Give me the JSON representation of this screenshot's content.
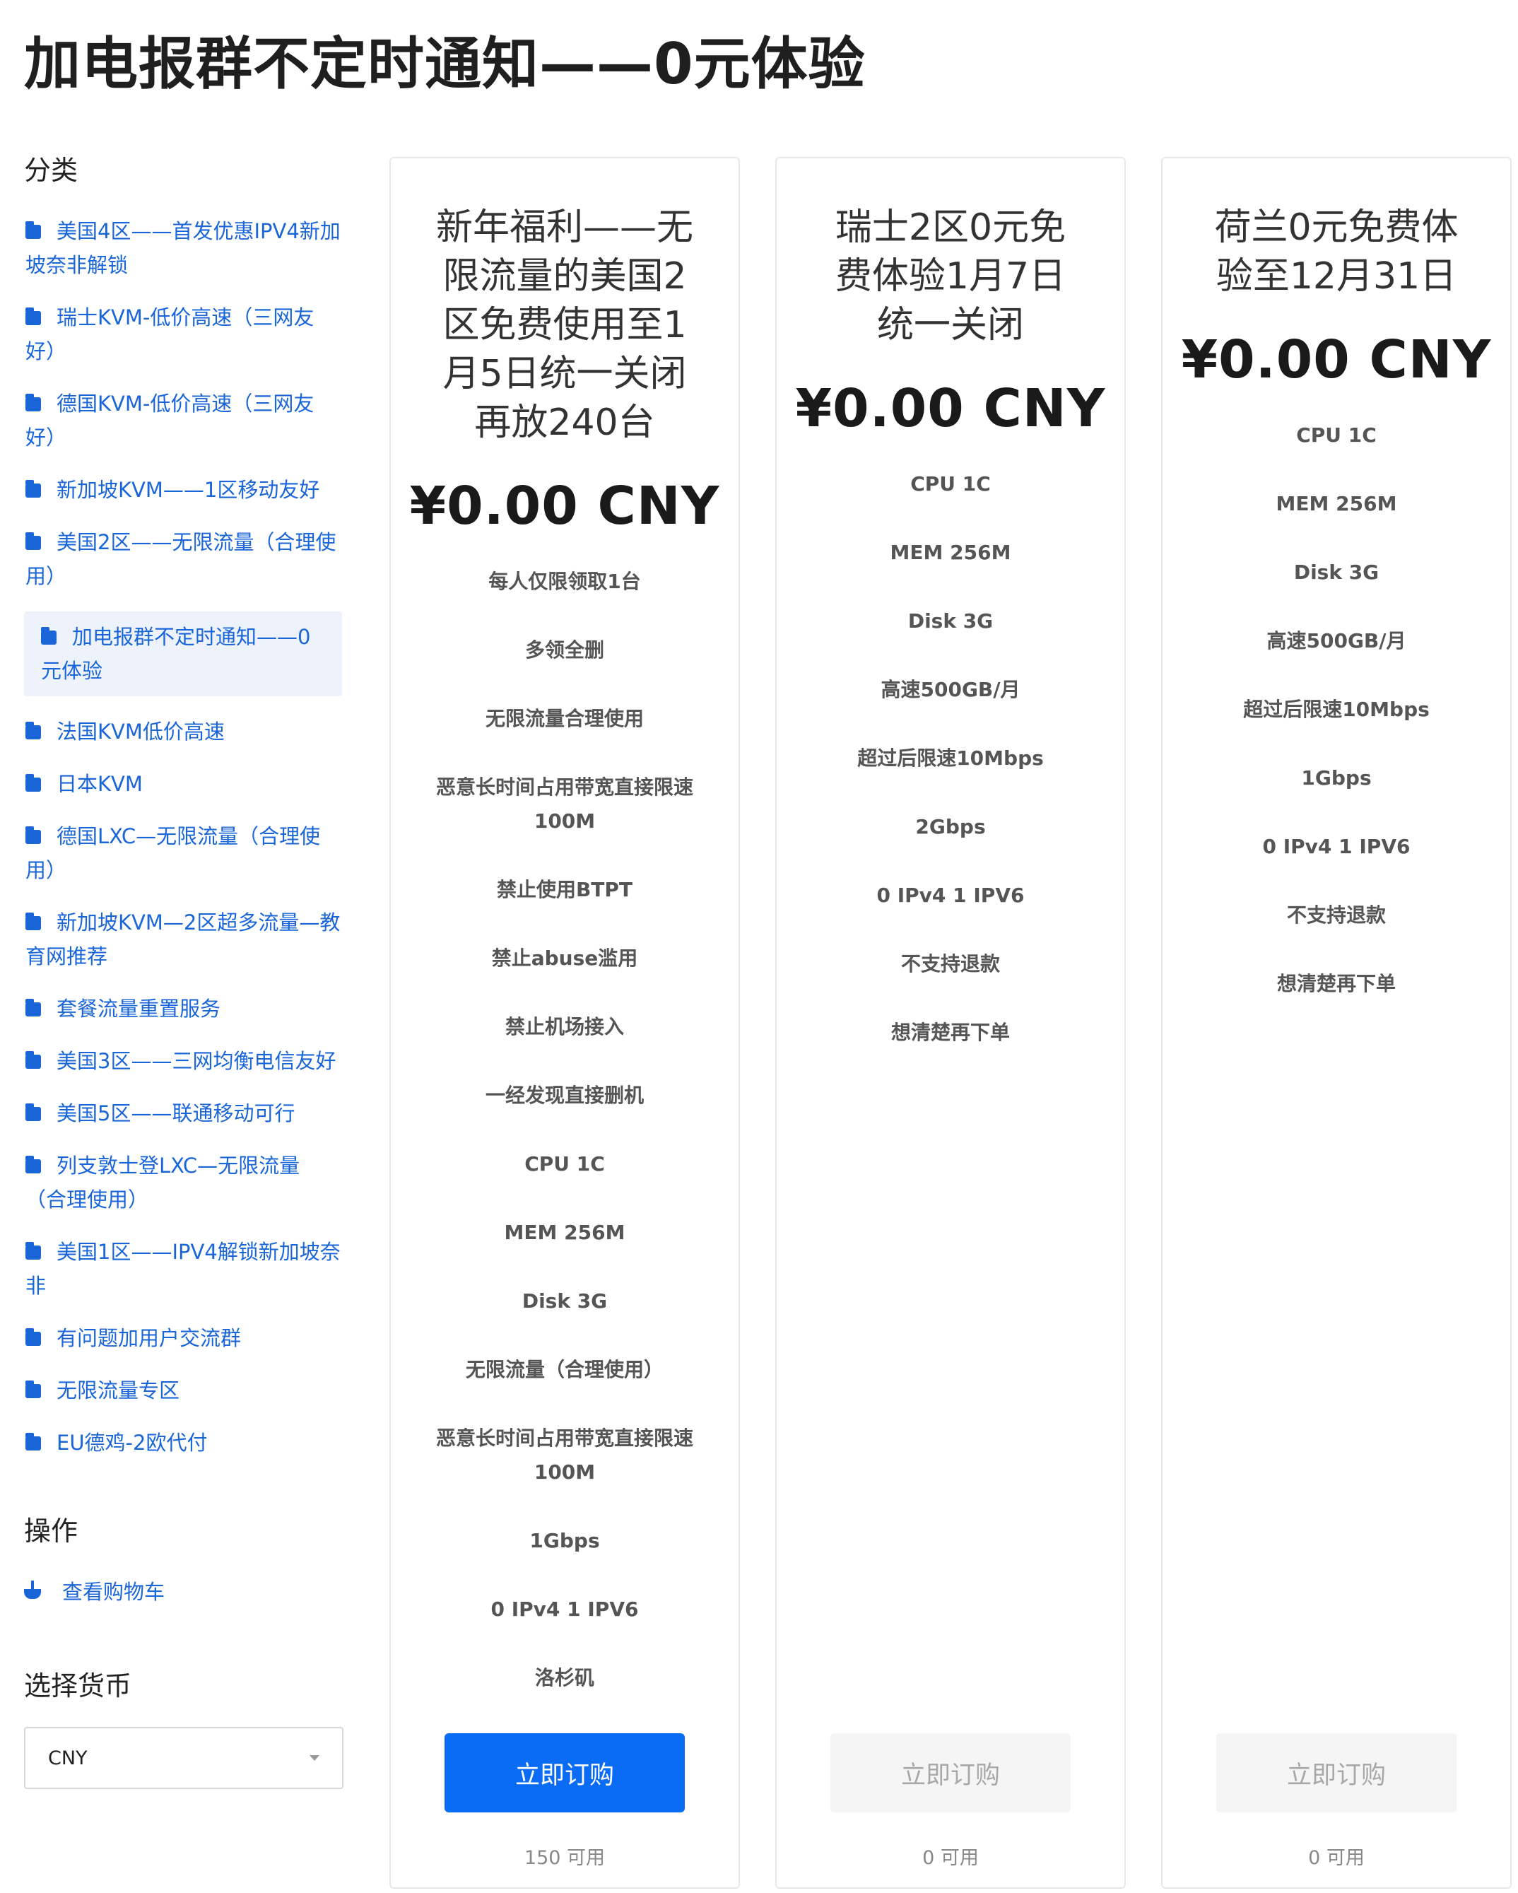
{
  "page": {
    "title": "加电报群不定时通知——0元体验"
  },
  "sidebar": {
    "categories_title": "分类",
    "categories": [
      {
        "label": "美国4区——首发优惠IPV4新加坡奈非解锁"
      },
      {
        "label": "瑞士KVM-低价高速（三网友好）"
      },
      {
        "label": "德国KVM-低价高速（三网友好）"
      },
      {
        "label": "新加坡KVM——1区移动友好"
      },
      {
        "label": "美国2区——无限流量（合理使用）"
      },
      {
        "label": "加电报群不定时通知——0元体验",
        "active": true
      },
      {
        "label": "法国KVM低价高速"
      },
      {
        "label": "日本KVM"
      },
      {
        "label": "德国LXC—无限流量（合理使用）"
      },
      {
        "label": "新加坡KVM—2区超多流量—教育网推荐"
      },
      {
        "label": "套餐流量重置服务"
      },
      {
        "label": "美国3区——三网均衡电信友好"
      },
      {
        "label": "美国5区——联通移动可行"
      },
      {
        "label": "列支敦士登LXC—无限流量（合理使用）"
      },
      {
        "label": "美国1区——IPV4解锁新加坡奈非"
      },
      {
        "label": "有问题加用户交流群"
      },
      {
        "label": "无限流量专区"
      },
      {
        "label": "EU德鸡-2欧代付"
      }
    ],
    "actions_title": "操作",
    "view_cart": "查看购物车",
    "currency_title": "选择货币",
    "currency_value": "CNY"
  },
  "products": [
    {
      "name": "新年福利——无限流量的美国2区免费使用至1月5日统一关闭再放240台",
      "price": "¥0.00 CNY",
      "features": [
        "每人仅限领取1台",
        "多领全删",
        "无限流量合理使用",
        "恶意长时间占用带宽直接限速100M",
        "禁止使用BTPT",
        "禁止abuse滥用",
        "禁止机场接入",
        "一经发现直接删机",
        "CPU 1C",
        "MEM 256M",
        "Disk 3G",
        "无限流量（合理使用）",
        "恶意长时间占用带宽直接限速100M",
        "1Gbps",
        "0 IPv4 1 IPV6",
        "洛杉矶"
      ],
      "button": "立即订购",
      "available": "150 可用",
      "enabled": true
    },
    {
      "name": "瑞士2区0元免费体验1月7日统一关闭",
      "price": "¥0.00 CNY",
      "features": [
        "CPU 1C",
        "MEM 256M",
        "Disk 3G",
        "高速500GB/月",
        "超过后限速10Mbps",
        "2Gbps",
        "0 IPv4 1 IPV6",
        "不支持退款",
        "想清楚再下单"
      ],
      "button": "立即订购",
      "available": "0 可用",
      "enabled": false
    },
    {
      "name": "荷兰0元免费体验至12月31日",
      "price": "¥0.00 CNY",
      "features": [
        "CPU 1C",
        "MEM 256M",
        "Disk 3G",
        "高速500GB/月",
        "超过后限速10Mbps",
        "1Gbps",
        "0 IPv4 1 IPV6",
        "不支持退款",
        "想清楚再下单"
      ],
      "button": "立即订购",
      "available": "0 可用",
      "enabled": false
    }
  ],
  "colors": {
    "link": "#1a66d9",
    "primary_button": "#0a6cf5",
    "disabled_button": "#f5f5f5"
  }
}
